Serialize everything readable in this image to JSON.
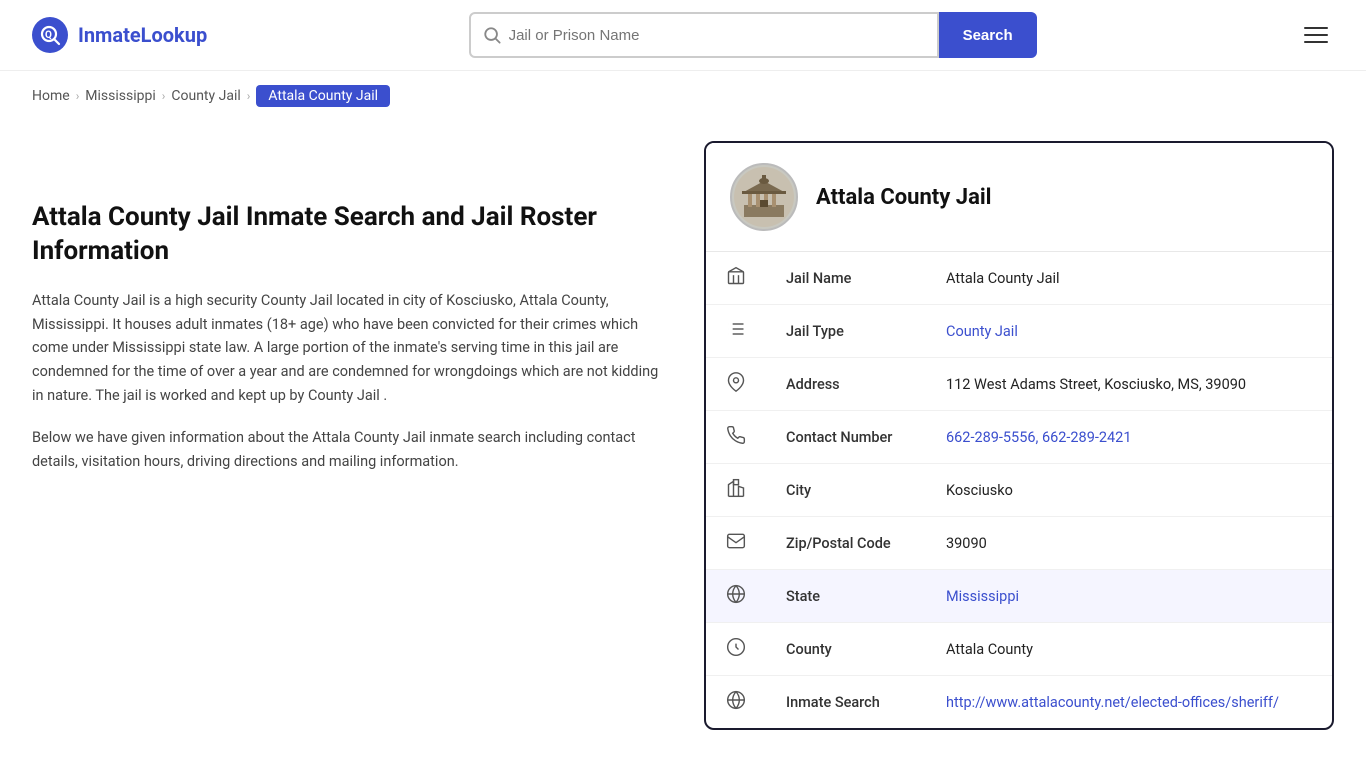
{
  "header": {
    "logo_text_start": "Inmate",
    "logo_text_end": "Lookup",
    "search_placeholder": "Jail or Prison Name",
    "search_btn_label": "Search",
    "logo_icon": "Q"
  },
  "breadcrumb": {
    "items": [
      {
        "label": "Home",
        "href": "#",
        "active": false
      },
      {
        "label": "Mississippi",
        "href": "#",
        "active": false
      },
      {
        "label": "County Jail",
        "href": "#",
        "active": false
      },
      {
        "label": "Attala County Jail",
        "href": "#",
        "active": true
      }
    ]
  },
  "left": {
    "title": "Attala County Jail Inmate Search and Jail Roster Information",
    "description1": "Attala County Jail is a high security County Jail located in city of Kosciusko, Attala County, Mississippi. It houses adult inmates (18+ age) who have been convicted for their crimes which come under Mississippi state law. A large portion of the inmate's serving time in this jail are condemned for the time of over a year and are condemned for wrongdoings which are not kidding in nature. The jail is worked and kept up by County Jail .",
    "description2": "Below we have given information about the Attala County Jail inmate search including contact details, visitation hours, driving directions and mailing information."
  },
  "card": {
    "jail_name_heading": "Attala County Jail",
    "rows": [
      {
        "label": "Jail Name",
        "value": "Attala County Jail",
        "link": false,
        "icon": "jail"
      },
      {
        "label": "Jail Type",
        "value": "County Jail",
        "link": true,
        "href": "#",
        "icon": "list"
      },
      {
        "label": "Address",
        "value": "112 West Adams Street, Kosciusko, MS, 39090",
        "link": false,
        "icon": "pin"
      },
      {
        "label": "Contact Number",
        "value": "662-289-5556, 662-289-2421",
        "link": true,
        "href": "tel:6622895556",
        "icon": "phone"
      },
      {
        "label": "City",
        "value": "Kosciusko",
        "link": false,
        "icon": "city"
      },
      {
        "label": "Zip/Postal Code",
        "value": "39090",
        "link": false,
        "icon": "mail"
      },
      {
        "label": "State",
        "value": "Mississippi",
        "link": true,
        "href": "#",
        "icon": "globe",
        "highlight": true
      },
      {
        "label": "County",
        "value": "Attala County",
        "link": false,
        "icon": "county"
      },
      {
        "label": "Inmate Search",
        "value": "http://www.attalacounty.net/elected-offices/sheriff/",
        "link": true,
        "href": "http://www.attalacounty.net/elected-offices/sheriff/",
        "icon": "globe2"
      }
    ]
  }
}
